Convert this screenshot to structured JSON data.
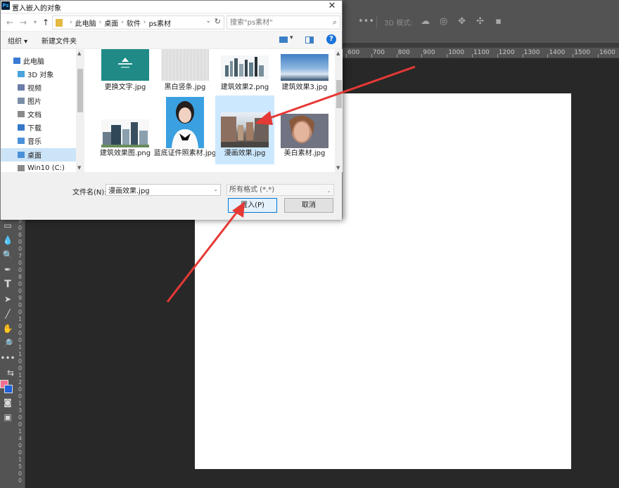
{
  "photoshop": {
    "mode_label": "3D 模式:",
    "ruler_top": [
      "600",
      "700",
      "800",
      "900",
      "1000",
      "1100",
      "1200",
      "1300",
      "1400",
      "1500",
      "1600"
    ],
    "ruler_left": [
      "5",
      "0",
      "6",
      "0",
      "0",
      "7",
      "0",
      "0",
      "8",
      "0",
      "0",
      "9",
      "0",
      "0",
      "1",
      "0",
      "0",
      "0",
      "1",
      "1",
      "0",
      "0",
      "1",
      "2",
      "0",
      "0",
      "1",
      "3",
      "0",
      "0",
      "1",
      "4",
      "0",
      "0",
      "1",
      "5",
      "0",
      "0"
    ],
    "canvas_color": "#ffffff",
    "workspace_color": "#282828"
  },
  "dialog": {
    "title": "置入嵌入的对象",
    "logo": "Ps",
    "close": "✕",
    "breadcrumb": [
      "此电脑",
      "桌面",
      "软件",
      "ps素材"
    ],
    "search_placeholder": "搜索\"ps素材\"",
    "toolbar": {
      "organize": "组织 ▾",
      "new_folder": "新建文件夹"
    },
    "nav_items": [
      {
        "label": "此电脑",
        "icon": "computer-icon",
        "color": "#3a7bd5"
      },
      {
        "label": "3D 对象",
        "icon": "cube-icon",
        "color": "#4aa3df"
      },
      {
        "label": "视频",
        "icon": "video-folder-icon",
        "color": "#6b7ea8"
      },
      {
        "label": "图片",
        "icon": "pictures-folder-icon",
        "color": "#7a8ea6"
      },
      {
        "label": "文档",
        "icon": "documents-folder-icon",
        "color": "#8a8a8a"
      },
      {
        "label": "下载",
        "icon": "download-folder-icon",
        "color": "#3478c9"
      },
      {
        "label": "音乐",
        "icon": "music-folder-icon",
        "color": "#4a90d9"
      },
      {
        "label": "桌面",
        "icon": "desktop-folder-icon",
        "color": "#4a90d9"
      },
      {
        "label": "Win10 (C:)",
        "icon": "drive-icon",
        "color": "#8a8a8a"
      }
    ],
    "files": [
      {
        "name": "更换文字.jpg",
        "thumb": "teal"
      },
      {
        "name": "黑白竖条.jpg",
        "thumb": "stripes"
      },
      {
        "name": "建筑效果2.png",
        "thumb": "skyline"
      },
      {
        "name": "建筑效果3.jpg",
        "thumb": "sky"
      },
      {
        "name": "建筑效果图.png",
        "thumb": "buildings"
      },
      {
        "name": "蓝底证件照素材.jpg",
        "thumb": "portrait"
      },
      {
        "name": "漫画效果.jpg",
        "thumb": "street"
      },
      {
        "name": "美白素材.jpg",
        "thumb": "face"
      }
    ],
    "filename_label": "文件名(N):",
    "filename_value": "漫画效果.jpg",
    "filetype": "所有格式 (*.*)",
    "place_button": "置入(P)",
    "cancel_button": "取消",
    "accent_color": "#0078d7",
    "selection_color": "#cce8ff"
  },
  "annotation_color": "#e53935"
}
